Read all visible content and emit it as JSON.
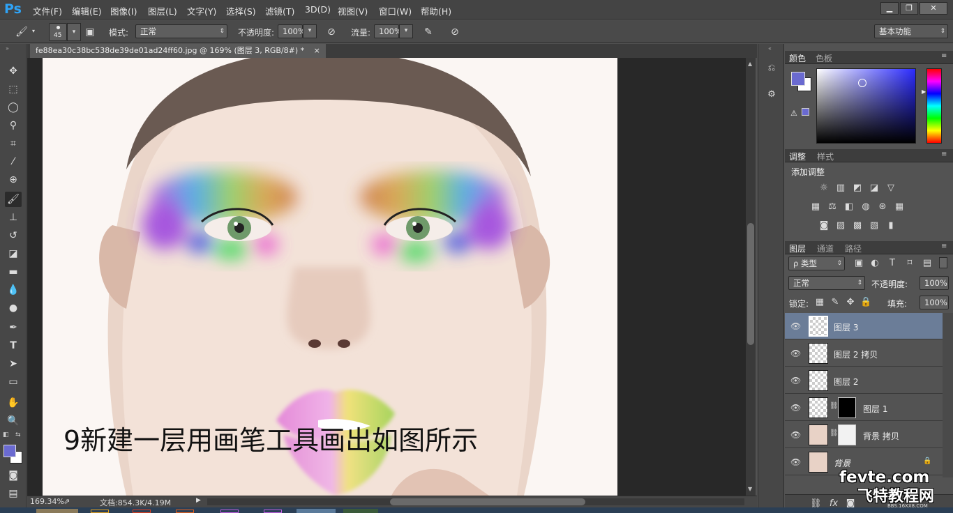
{
  "app": {
    "logo": "Ps"
  },
  "menu": [
    "文件(F)",
    "编辑(E)",
    "图像(I)",
    "图层(L)",
    "文字(Y)",
    "选择(S)",
    "滤镜(T)",
    "3D(D)",
    "视图(V)",
    "窗口(W)",
    "帮助(H)"
  ],
  "options": {
    "brush_size": "45",
    "mode_label": "模式:",
    "mode_value": "正常",
    "opacity_label": "不透明度:",
    "opacity_value": "100%",
    "flow_label": "流量:",
    "flow_value": "100%",
    "workspace": "基本功能"
  },
  "document": {
    "tab_title": "fe88ea30c38bc538de39de01ad24ff60.jpg @ 169% (图层 3, RGB/8#) *",
    "annotation": "9新建一层用画笔工具画出如图所示",
    "zoom": "169.34%",
    "doc_size": "文档:854.3K/4.19M"
  },
  "color_panel": {
    "tabs": [
      "颜色",
      "色板"
    ],
    "foreground": "#6a6ad0"
  },
  "adjust_panel": {
    "tabs": [
      "调整",
      "样式"
    ],
    "title": "添加调整"
  },
  "layers_panel": {
    "tabs": [
      "图层",
      "通道",
      "路径"
    ],
    "filter_label": "ρ 类型",
    "blend_mode": "正常",
    "opacity_label": "不透明度:",
    "opacity_value": "100%",
    "lock_label": "锁定:",
    "fill_label": "填充:",
    "fill_value": "100%",
    "layers": [
      {
        "name": "图层 3",
        "selected": true
      },
      {
        "name": "图层 2 拷贝",
        "selected": false
      },
      {
        "name": "图层 2",
        "selected": false
      },
      {
        "name": "图层 1",
        "selected": false
      },
      {
        "name": "背景 拷贝",
        "selected": false
      },
      {
        "name": "背景",
        "selected": false
      }
    ]
  },
  "watermark": {
    "site": "fevte.com",
    "cn": "飞特教程网",
    "url": "BBS.16XX8.COM"
  }
}
